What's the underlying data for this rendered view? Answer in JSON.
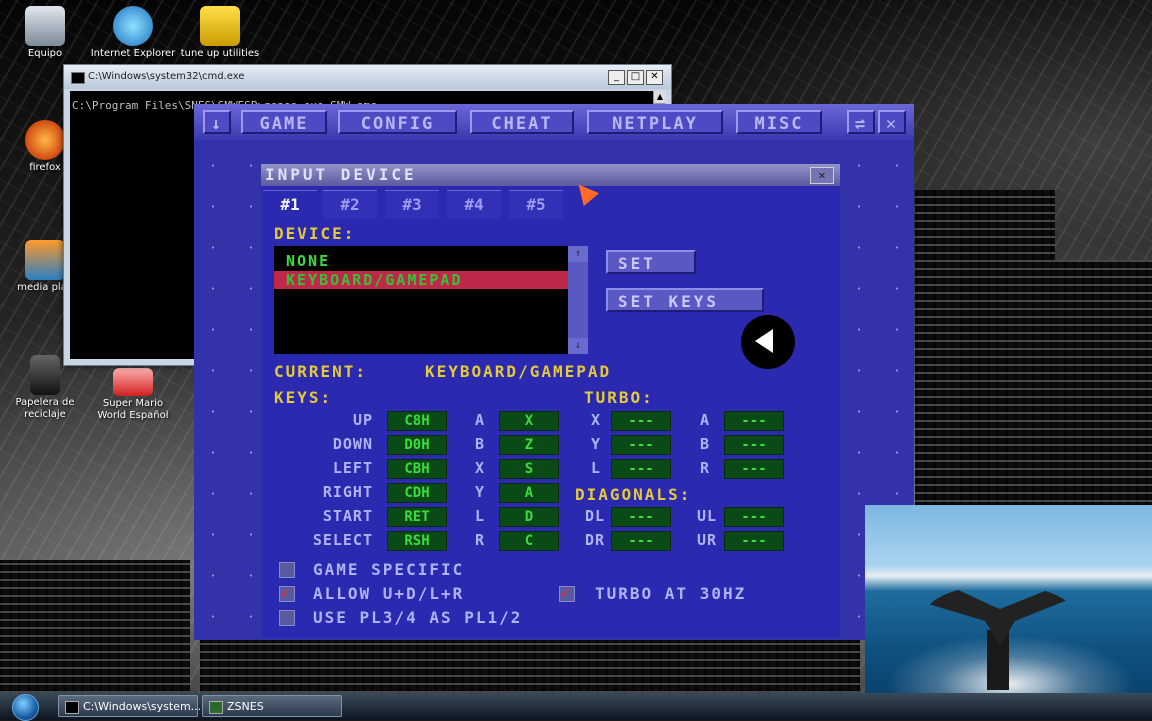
{
  "desktop": {
    "icons": [
      {
        "label": "Equipo",
        "icon": "computer-icon"
      },
      {
        "label": "Internet Explorer",
        "icon": "internet-explorer-icon"
      },
      {
        "label": "tune up utilities",
        "icon": "tuneup-icon"
      },
      {
        "label": "firefox",
        "icon": "firefox-icon"
      },
      {
        "label": "media play",
        "icon": "media-player-icon"
      },
      {
        "label": "Papelera de reciclaje",
        "icon": "recycle-bin-icon"
      },
      {
        "label": "Super Mario World Español",
        "icon": "super-mario-icon"
      }
    ]
  },
  "cmd": {
    "title": "C:\\Windows\\system32\\cmd.exe",
    "text": "C:\\Program Files\\SNES\\SMWESP>zsnes.exe SMW.smc",
    "controls": [
      "_",
      "□",
      "✕"
    ]
  },
  "zsnes": {
    "menu": {
      "arrow": "↓",
      "items": [
        "GAME",
        "CONFIG",
        "CHEAT",
        "NETPLAY",
        "MISC"
      ],
      "minimize": "⇌",
      "close": "✕"
    },
    "dialog": {
      "title": "INPUT DEVICE",
      "close": "✕",
      "tabs": [
        "#1",
        "#2",
        "#3",
        "#4",
        "#5"
      ],
      "device_label": "DEVICE:",
      "devices": [
        "NONE",
        "KEYBOARD/GAMEPAD"
      ],
      "scroll_up": "⇑",
      "scroll_down": "⇓",
      "set_button": "SET",
      "set_keys_button": "SET KEYS",
      "current_label": "CURRENT:",
      "current_value": "KEYBOARD/GAMEPAD",
      "keys_label": "KEYS:",
      "turbo_label": "TURBO:",
      "diagonals_label": "DIAGONALS:",
      "dirs": [
        {
          "label": "UP",
          "value": "C8H"
        },
        {
          "label": "DOWN",
          "value": "D0H"
        },
        {
          "label": "LEFT",
          "value": "CBH"
        },
        {
          "label": "RIGHT",
          "value": "CDH"
        },
        {
          "label": "START",
          "value": "RET"
        },
        {
          "label": "SELECT",
          "value": "RSH"
        }
      ],
      "buttons": [
        {
          "label": "A",
          "value": "X"
        },
        {
          "label": "B",
          "value": "Z"
        },
        {
          "label": "X",
          "value": "S"
        },
        {
          "label": "Y",
          "value": "A"
        },
        {
          "label": "L",
          "value": "D"
        },
        {
          "label": "R",
          "value": "C"
        }
      ],
      "turbo": [
        {
          "label": "X",
          "value": "---"
        },
        {
          "label": "A",
          "value": "---"
        },
        {
          "label": "Y",
          "value": "---"
        },
        {
          "label": "B",
          "value": "---"
        },
        {
          "label": "L",
          "value": "---"
        },
        {
          "label": "R",
          "value": "---"
        }
      ],
      "diagonals": [
        {
          "label": "DL",
          "value": "---"
        },
        {
          "label": "UL",
          "value": "---"
        },
        {
          "label": "DR",
          "value": "---"
        },
        {
          "label": "UR",
          "value": "---"
        }
      ],
      "checks": {
        "game_specific": "GAME SPECIFIC",
        "allow": "ALLOW U+D/L+R",
        "turbo30": "TURBO AT 30HZ",
        "use_pl": "USE PL3/4 AS PL1/2",
        "check_mark": "✓"
      }
    }
  },
  "taskbar": {
    "tasks": [
      "C:\\Windows\\system...",
      "ZSNES"
    ]
  },
  "colors": {
    "zsnes_bg": "#3432a8",
    "label_yellow": "#e4c93a",
    "key_green": "#3ddc3d",
    "selection_red": "#c0284a"
  }
}
